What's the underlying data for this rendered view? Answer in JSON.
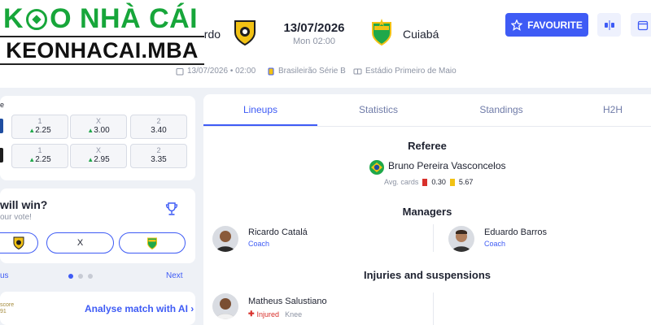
{
  "logo": {
    "top": "KÈO NHÀ CÁI",
    "top_pre": "K",
    "top_post": "O NHÀ CÁI",
    "bottom": "KEONHACAI.MBA"
  },
  "match": {
    "home_name": "ardo",
    "away_name": "Cuiabá",
    "date": "13/07/2026",
    "time": "Mon 02:00",
    "meta_datetime": "13/07/2026 • 02:00",
    "league": "Brasileirão Série B",
    "stadium": "Estádio Primeiro de Maio"
  },
  "header": {
    "favourite_label": "FAVOURITE"
  },
  "odds": {
    "row_label": "e",
    "rows": [
      {
        "bookmaker_color": "#1f4ea1",
        "cells": [
          {
            "label": "1",
            "value": "2.25",
            "trend": "up"
          },
          {
            "label": "X",
            "value": "3.00",
            "trend": "up"
          },
          {
            "label": "2",
            "value": "3.40",
            "trend": ""
          }
        ]
      },
      {
        "bookmaker_color": "#1e1e1e",
        "cells": [
          {
            "label": "1",
            "value": "2.25",
            "trend": "up"
          },
          {
            "label": "X",
            "value": "2.95",
            "trend": "up"
          },
          {
            "label": "2",
            "value": "3.35",
            "trend": ""
          }
        ]
      }
    ]
  },
  "vote": {
    "title": "will win?",
    "subtitle": "our vote!",
    "draw_label": "X"
  },
  "pager": {
    "prev": "us",
    "next": "Next"
  },
  "ai": {
    "logo_line1": "score",
    "logo_line2": "91",
    "link": "Analyse match with AI"
  },
  "tabs": [
    "Lineups",
    "Statistics",
    "Standings",
    "H2H"
  ],
  "referee": {
    "title": "Referee",
    "name": "Bruno Pereira Vasconcelos",
    "avg_label": "Avg. cards",
    "red_avg": "0.30",
    "yellow_avg": "5.67"
  },
  "managers": {
    "title": "Managers",
    "home": {
      "name": "Ricardo Catalá",
      "role": "Coach"
    },
    "away": {
      "name": "Eduardo Barros",
      "role": "Coach"
    }
  },
  "injuries": {
    "title": "Injuries and suspensions",
    "players": [
      {
        "name": "Matheus Salustiano",
        "status": "Injured",
        "detail": "Knee"
      }
    ]
  },
  "colors": {
    "accent": "#3e5bf5",
    "logo_green": "#17a63a",
    "background": "#eef1f6"
  }
}
